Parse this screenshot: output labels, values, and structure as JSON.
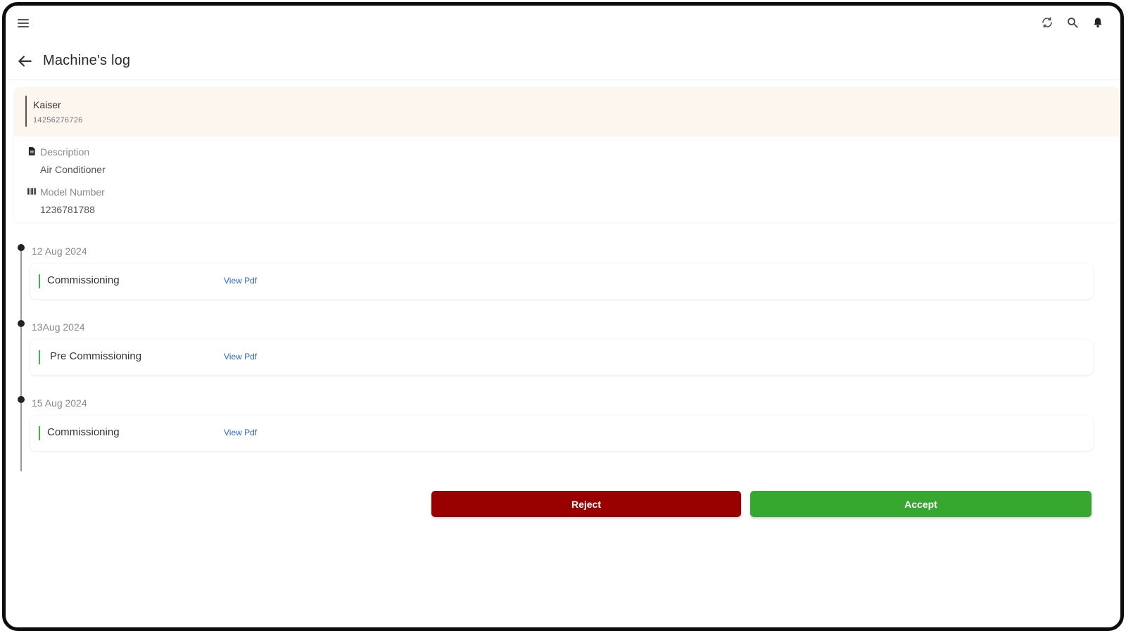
{
  "header": {
    "title": "Machine's log"
  },
  "machine": {
    "brand": "Kaiser",
    "serial": "14256276726",
    "description_label": "Description",
    "description_value": "Air Conditioner",
    "model_label": "Model Number",
    "model_value": "1236781788"
  },
  "logs": [
    {
      "date": "12 Aug 2024",
      "type": "Commissioning",
      "link": "View Pdf"
    },
    {
      "date": "13Aug 2024",
      "type": "Pre Commissioning",
      "link": "View Pdf"
    },
    {
      "date": "15 Aug 2024",
      "type": "Commissioning",
      "link": "View Pdf"
    }
  ],
  "actions": {
    "reject": "Reject",
    "accept": "Accept"
  },
  "colors": {
    "reject": "#990000",
    "accept": "#36a72f",
    "link": "#2f66e0",
    "brand_band": "#fdf6ef"
  },
  "icons": [
    "menu-icon",
    "sync-icon",
    "search-icon",
    "bell-icon",
    "back-arrow-icon",
    "document-icon",
    "barcode-icon"
  ]
}
